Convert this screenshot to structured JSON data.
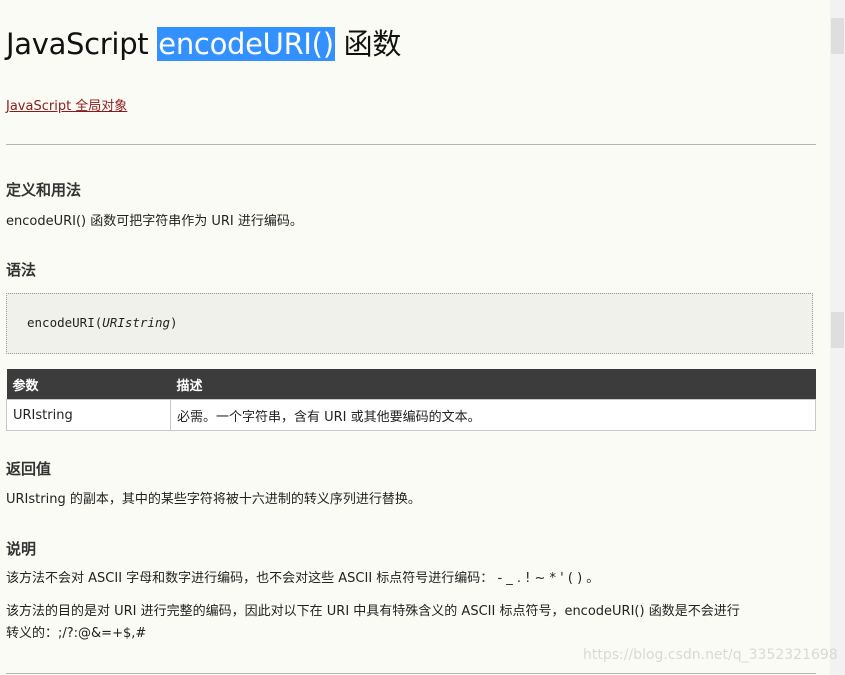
{
  "title": {
    "prefix": "JavaScript ",
    "highlight": "encodeURI()",
    "suffix": " 函数"
  },
  "breadcrumb_link": "JavaScript 全局对象",
  "sections": {
    "definition": {
      "heading": "定义和用法",
      "text": "encodeURI() 函数可把字符串作为 URI 进行编码。"
    },
    "syntax": {
      "heading": "语法",
      "code_prefix": "encodeURI(",
      "code_param": "URIstring",
      "code_suffix": ")"
    },
    "params_table": {
      "headers": [
        "参数",
        "描述"
      ],
      "rows": [
        [
          "URIstring",
          "必需。一个字符串，含有 URI 或其他要编码的文本。"
        ]
      ]
    },
    "return_value": {
      "heading": "返回值",
      "text": "URIstring 的副本，其中的某些字符将被十六进制的转义序列进行替换。"
    },
    "description": {
      "heading": "说明",
      "text1": "该方法不会对 ASCII 字母和数字进行编码，也不会对这些 ASCII 标点符号进行编码： - _ . ! ~ * ' ( ) 。",
      "text2_line1": "该方法的目的是对 URI 进行完整的编码，因此对以下在 URI 中具有特殊含义的 ASCII 标点符号，encodeURI() 函数是不会进行",
      "text2_line2": "转义的：;/?:@&=+$,#"
    }
  },
  "watermark": "https://blog.csdn.net/q_3352321698",
  "colors": {
    "background": "#fbfbf6",
    "selection": "#3390ff",
    "link": "#8b1a1a",
    "table_header": "#3c3c3c"
  }
}
